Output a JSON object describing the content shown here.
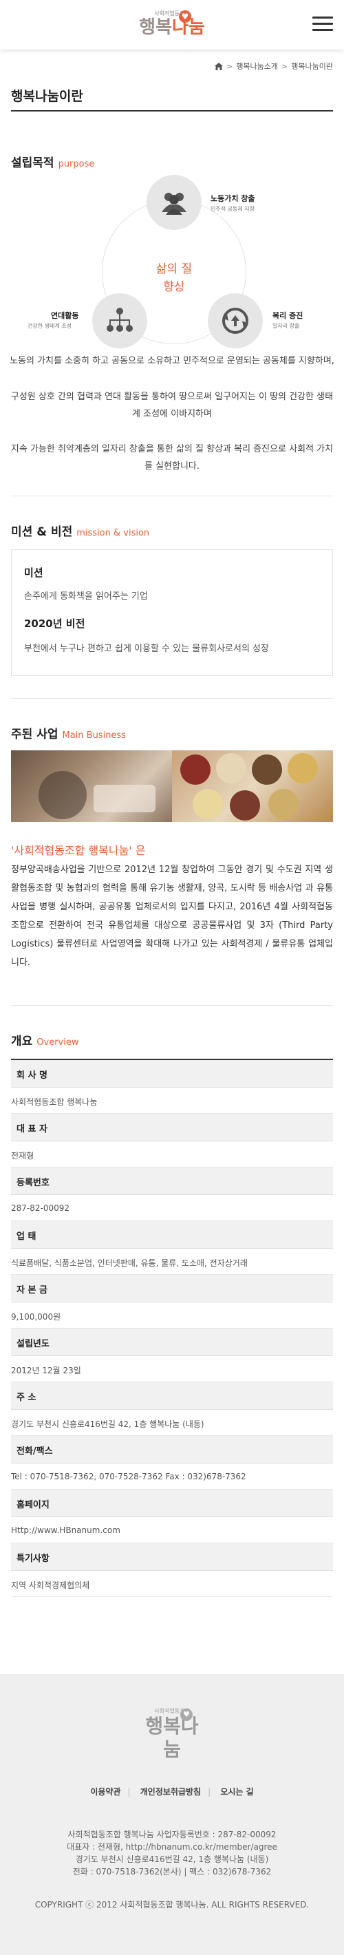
{
  "header": {
    "logo_sub": "사회적협동조합",
    "logo_main_a": "행복",
    "logo_main_b": "나눔",
    "menu_icon": "hamburger-icon"
  },
  "breadcrumb": {
    "home_icon": "home-icon",
    "items": [
      "행복나눔소개",
      "행복나눔이란"
    ],
    "separator": ">"
  },
  "page_title": "행복나눔이란",
  "purpose": {
    "title": "설립목적",
    "title_en": "purpose",
    "center": "삶의 질\n향상",
    "nodes": [
      {
        "label": "노동가치 창출",
        "desc": "민주적 공동체 지향",
        "icon": "people-icon"
      },
      {
        "label": "연대활동",
        "desc": "건강한 생태계 조성",
        "icon": "network-icon"
      },
      {
        "label": "복리 증진",
        "desc": "일자리 창출",
        "icon": "recycle-icon"
      }
    ],
    "paragraph": [
      "노동의 가치를 소중히 하고 공동으로 소유하고 민주적으로 운영되는 공동체를 지향하며,",
      "구성원 상호 간의 협력과 연대 활동을 통하여 땅으로써 일구어지는 이 땅의 건강한 생태계 조성에 이바지하며",
      "지속 가능한 취약계층의 일자리 창출을 통한 삶의 질 향상과 복리 증진으로 사회적 가치를 실현합니다."
    ]
  },
  "mission": {
    "title": "미션 & 비전",
    "title_en": "mission & vision",
    "mission_h": "미션",
    "mission_t": "손주에게 동화책을 읽어주는 기업",
    "vision_h": "2020년 비전",
    "vision_t": "부천에서 누구나 편하고 쉽게 이용할 수 있는 물류회사로서의 성장"
  },
  "business": {
    "title": "주된 사업",
    "title_en": "Main Business",
    "heading": "'사회적협동조합 행복나눔' 은",
    "text": "정부양곡배송사업을 기반으로 2012년 12월 창업하여 그동안 경기 및 수도권 지역 생활협동조합 및 농협과의 협력을 통해 유기농 생활재, 양곡, 도시락 등 배송사업 과 유통사업을 병행 실시하며, 공공유통 업체로서의 입지를 다지고, 2016년 4월 사회적협동조합으로 전환하여 전국 유통업체를 대상으로 공공물류사업 및 3자 (Third Party Logistics) 물류센터로 사업영역을 확대해 나가고 있는 사회적경제 / 물류유통 업체입니다."
  },
  "overview": {
    "title": "개요",
    "title_en": "Overview",
    "rows": [
      {
        "label": "회 사 명",
        "value": "사회적협동조합 행복나눔"
      },
      {
        "label": "대 표 자",
        "value": "전재형"
      },
      {
        "label": "등록번호",
        "value": "287-82-00092"
      },
      {
        "label": "업 태",
        "value": "식료품배달, 식품소분업, 인터넷판매, 유통, 물류, 도소매, 전자상거래"
      },
      {
        "label": "자 본 금",
        "value": "9,100,000원"
      },
      {
        "label": "설립년도",
        "value": "2012년 12월 23일"
      },
      {
        "label": "주 소",
        "value": "경기도 부천시 신흥로416번길 42, 1층 행복나눔 (내동)"
      },
      {
        "label": "전화/팩스",
        "value": "Tel : 070-7518-7362, 070-7528-7362 Fax : 032)678-7362"
      },
      {
        "label": "홈페이지",
        "value": "Http://www.HBnanum.com"
      },
      {
        "label": "특기사항",
        "value": "지역 사회적경제협의체"
      }
    ]
  },
  "footer": {
    "logo_sub": "사회적협동조합",
    "logo_main": "행복나눔",
    "links": [
      "이용약관",
      "개인정보취급방침",
      "오시는 길"
    ],
    "info": [
      "사회적협동조합 행복나눔 사업자등록번호 : 287-82-00092",
      "대표자 : 전재형, http://hbnanum.co.kr/member/agree",
      "경기도 부천시 신흥로416번길 42, 1층 행복나눔 (내동)",
      "전화 : 070-7518-7362(본사)  |  팩스 : 032)678-7362"
    ],
    "copyright": "COPYRIGHT ⓒ 2012 사회적협동조합 행복나눔. ALL RIGHTS RESERVED."
  },
  "colors": {
    "accent": "#e9603c",
    "muted": "#9b8f89",
    "footer_bg": "#efefef"
  }
}
